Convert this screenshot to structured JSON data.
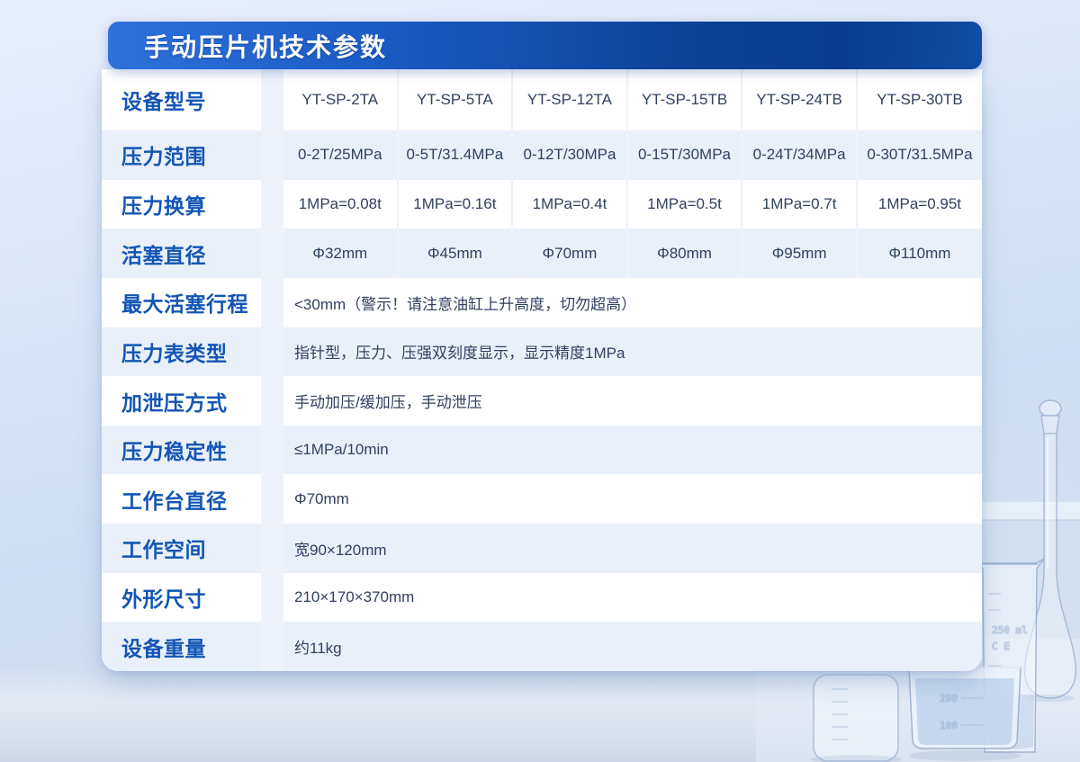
{
  "banner": {
    "title": "手动压片机技术参数"
  },
  "table": {
    "rows": [
      {
        "label": "设备型号",
        "values": [
          "YT-SP-2TA",
          "YT-SP-5TA",
          "YT-SP-12TA",
          "YT-SP-15TB",
          "YT-SP-24TB",
          "YT-SP-30TB"
        ]
      },
      {
        "label": "压力范围",
        "values": [
          "0-2T/25MPa",
          "0-5T/31.4MPa",
          "0-12T/30MPa",
          "0-15T/30MPa",
          "0-24T/34MPa",
          "0-30T/31.5MPa"
        ]
      },
      {
        "label": "压力换算",
        "values": [
          "1MPa=0.08t",
          "1MPa=0.16t",
          "1MPa=0.4t",
          "1MPa=0.5t",
          "1MPa=0.7t",
          "1MPa=0.95t"
        ]
      },
      {
        "label": "活塞直径",
        "values": [
          "Φ32mm",
          "Φ45mm",
          "Φ70mm",
          "Φ80mm",
          "Φ95mm",
          "Φ110mm"
        ]
      },
      {
        "label": "最大活塞行程",
        "value": "<30mm（警示！请注意油缸上升高度，切勿超高）"
      },
      {
        "label": "压力表类型",
        "value": "指针型，压力、压强双刻度显示，显示精度1MPa"
      },
      {
        "label": "加泄压方式",
        "value": "手动加压/缓加压，手动泄压"
      },
      {
        "label": "压力稳定性",
        "value": "≤1MPa/10min"
      },
      {
        "label": "工作台直径",
        "value": "Φ70mm"
      },
      {
        "label": "工作空间",
        "value": "宽90×120mm"
      },
      {
        "label": "外形尺寸",
        "value": "210×170×370mm"
      },
      {
        "label": "设备重量",
        "value": "约11kg"
      }
    ]
  },
  "colors": {
    "banner_gradient_start": "#2f71dc",
    "banner_gradient_end": "#0a3d8e",
    "label_blue": "#1355b4",
    "value_dark": "#324061",
    "row_tint": "#e9f0fa",
    "page_background": "#d6e2f4"
  },
  "decor": {
    "glassware_items": [
      "graduated-bottle",
      "liquid-beaker",
      "spouted-beaker",
      "volumetric-flask"
    ],
    "beaker_marks": [
      "250 ml",
      "200",
      "100"
    ]
  }
}
